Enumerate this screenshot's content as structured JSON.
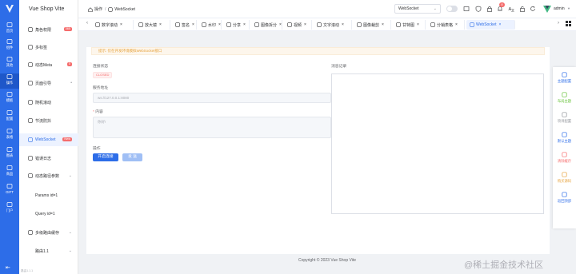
{
  "rail": {
    "items": [
      {
        "label": "首页",
        "icon": "home-icon"
      },
      {
        "label": "组件",
        "icon": "component-icon"
      },
      {
        "label": "其他",
        "icon": "more-icon"
      },
      {
        "label": "操作",
        "icon": "operation-icon"
      },
      {
        "label": "模板",
        "icon": "template-icon"
      },
      {
        "label": "配置",
        "icon": "settings-icon"
      },
      {
        "label": "表格",
        "icon": "table-icon"
      },
      {
        "label": "图表",
        "icon": "chart-icon"
      },
      {
        "label": "商品",
        "icon": "goods-icon"
      },
      {
        "label": "GIFT",
        "icon": "gift-icon"
      },
      {
        "label": "门户",
        "icon": "portal-icon"
      }
    ]
  },
  "sidebar": {
    "brand": "Vue Shop Vite",
    "items": [
      {
        "label": "角色权限",
        "badge": "365",
        "icon": "user-shield-icon"
      },
      {
        "label": "多标签",
        "icon": "tabs-icon"
      },
      {
        "label": "动态Meta",
        "badge": "0",
        "icon": "meta-icon"
      },
      {
        "label": "页面引导",
        "arrow": "•",
        "icon": "guide-icon"
      },
      {
        "label": "随机滚动",
        "icon": "random-icon"
      },
      {
        "label": "节流防抖",
        "icon": "throttle-icon"
      },
      {
        "label": "WebSocket",
        "badge": "New",
        "icon": "websocket-icon"
      },
      {
        "label": "错误日志",
        "icon": "log-icon"
      },
      {
        "label": "动态路径参数",
        "arrow": "⌄",
        "icon": "route-icon"
      },
      {
        "label": "Params id=1"
      },
      {
        "label": "Query id=1"
      },
      {
        "label": "多级路由缓存",
        "arrow": "⌄",
        "icon": "cache-icon"
      },
      {
        "label": "路由1.1",
        "arrow": "⌄"
      }
    ],
    "footer": "路由1.1.1"
  },
  "header": {
    "breadcrumb": [
      "操作",
      "WebSocket"
    ],
    "theme_select": "WebSocket",
    "notification_count": "8",
    "username": "admin"
  },
  "tabs": [
    {
      "label": "数字滚动",
      "icon": "number-icon"
    },
    {
      "label": "放大镜",
      "icon": "magnifier-icon"
    },
    {
      "label": "签名",
      "icon": "signature-icon"
    },
    {
      "label": "水印",
      "icon": "watermark-icon"
    },
    {
      "label": "分享",
      "icon": "share-icon"
    },
    {
      "label": "图像拆分",
      "icon": "image-split-icon"
    },
    {
      "label": "视频",
      "icon": "video-icon"
    },
    {
      "label": "文字滚动",
      "icon": "text-scroll-icon"
    },
    {
      "label": "图像裁剪",
      "icon": "crop-icon"
    },
    {
      "label": "甘特图",
      "icon": "gantt-icon"
    },
    {
      "label": "分销表格",
      "icon": "table-icon"
    },
    {
      "label": "WebSocket",
      "icon": "websocket-icon"
    }
  ],
  "content": {
    "alert": "提示: 仅在开发环境模拟WebSocket接口",
    "status_label": "连接状态",
    "status_value": "CLOSED",
    "server_label": "服务地址",
    "server_placeholder": "ws://127.0.0.1:8080",
    "content_label": "内容",
    "content_placeholder": "你好!",
    "action_label": "操作",
    "open_button": "开启连接",
    "send_button": "发 送",
    "log_label": "消息记录"
  },
  "float_panel": [
    {
      "label": "主题配置",
      "icon": "theme-config-icon",
      "color": "#2d6de8"
    },
    {
      "label": "布局主题",
      "icon": "layout-theme-icon",
      "color": "#67c23a"
    },
    {
      "label": "项目配置",
      "icon": "project-config-icon",
      "color": "#909399"
    },
    {
      "label": "默认主题",
      "icon": "undo-icon",
      "color": "#2d6de8"
    },
    {
      "label": "清除缓存",
      "icon": "clear-cache-icon",
      "color": "#f56c6c"
    },
    {
      "label": "购买源码",
      "icon": "purchase-icon",
      "color": "#e6a23c"
    },
    {
      "label": "返回顶部",
      "icon": "back-top-icon",
      "color": "#2d6de8"
    }
  ],
  "footer": "Copyright © 2023 Vue Shop Vite",
  "watermark": "@稀土掘金技术社区",
  "colors": {
    "primary": "#2d6de8",
    "danger": "#f56c6c",
    "warning": "#e6a23c",
    "success": "#67c23a"
  }
}
